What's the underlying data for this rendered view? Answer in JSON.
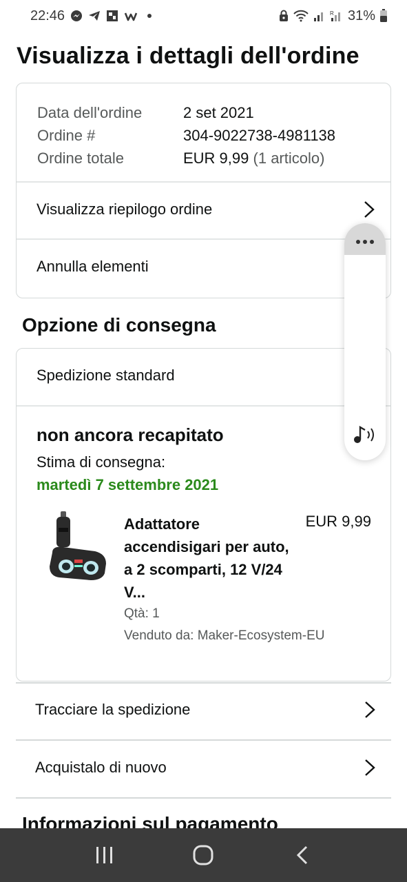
{
  "status_bar": {
    "time": "22:46",
    "battery": "31%",
    "icons": [
      "messenger-icon",
      "telegram-icon",
      "app-icon",
      "w-icon",
      "dot-icon",
      "lock-icon",
      "wifi-icon",
      "signal-icon",
      "signal-r-icon",
      "battery-icon"
    ]
  },
  "page": {
    "title": "Visualizza i dettagli dell'ordine"
  },
  "order_summary": {
    "rows": [
      {
        "key": "Data dell'ordine",
        "value": "2 set 2021"
      },
      {
        "key": "Ordine #",
        "value": "304-9022738-4981138"
      },
      {
        "key": "Ordine totale",
        "value": "EUR 9,99",
        "extra": "(1 articolo)"
      }
    ],
    "view_summary_label": "Visualizza riepilogo ordine",
    "cancel_label": "Annulla elementi"
  },
  "delivery": {
    "section_title": "Opzione di consegna",
    "shipping_type": "Spedizione standard",
    "status": "non ancora recapitato",
    "estimate_label": "Stima di consegna:",
    "estimate_date": "martedì 7 settembre 2021",
    "item": {
      "title": "Adattatore accendisigari per auto, a 2 scomparti, 12 V/24 V...",
      "price": "EUR 9,99",
      "qty": "Qtà: 1",
      "seller": "Venduto da: Maker-Ecosystem-EU"
    }
  },
  "actions": {
    "track_label": "Tracciare la spedizione",
    "buy_again_label": "Acquistalo di nuovo"
  },
  "payment": {
    "section_title": "Informazioni sul pagamento"
  },
  "colors": {
    "accent_green": "#2b8a1c",
    "border": "#d5d9d9",
    "nav_bg": "#3b3b3b"
  }
}
